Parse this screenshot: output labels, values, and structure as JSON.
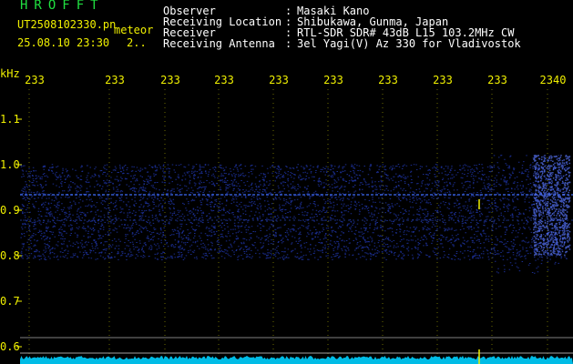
{
  "header": {
    "station_title": "HROFFT",
    "file_name": "UT2508102330.pn",
    "mode_label": "meteor",
    "date_time": "25.08.10 23:30",
    "count": "2..",
    "observer_label": "Observer",
    "observer_sep": ":",
    "observer_value": "Masaki Kano",
    "location_label": "Receiving Location",
    "location_sep": ":",
    "location_value": "Shibukawa, Gunma, Japan",
    "receiver_label": "Receiver",
    "receiver_sep": ":",
    "receiver_value": "RTL-SDR SDR# 43dB L15 103.2MHz CW",
    "antenna_label": "Receiving Antenna",
    "antenna_sep": ":",
    "antenna_value": "3el Yagi(V) Az 330 for Vladivostok"
  },
  "axes": {
    "y_unit": "kHz",
    "y_ticks": [
      "1.1",
      "1.0",
      "0.9",
      "0.8",
      "0.7",
      "0.6"
    ],
    "x_ticks": [
      "233",
      "233",
      "233",
      "233",
      "233",
      "233",
      "233",
      "233",
      "233",
      "2340"
    ]
  },
  "colors": {
    "background": "#000000",
    "text_yellow": "#f0f000",
    "text_white": "#ffffff",
    "title_green": "#20e040",
    "signal_blue": "#3050ff",
    "baseline_cyan": "#00d0ff"
  }
}
